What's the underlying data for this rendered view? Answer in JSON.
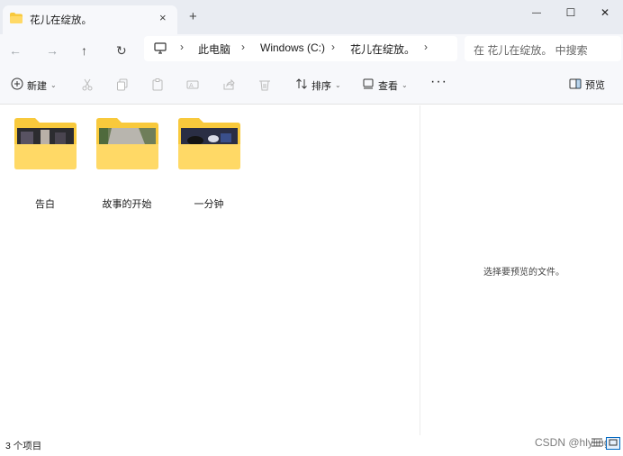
{
  "window": {
    "tab_title": "花儿在绽放。",
    "tab_close": "×",
    "new_tab": "+",
    "minimize": "—",
    "maximize": "☐",
    "close": "✕"
  },
  "nav": {
    "back": "←",
    "forward": "→",
    "up": "↑",
    "refresh": "↻"
  },
  "address": {
    "segments": [
      "此电脑",
      "Windows (C:)",
      "花儿在绽放。"
    ],
    "separator": "›"
  },
  "search": {
    "placeholder": "在 花儿在绽放。 中搜索"
  },
  "toolbar": {
    "new_label": "新建",
    "sort_label": "排序",
    "view_label": "查看",
    "more_label": "···",
    "preview_label": "预览",
    "caret": "⌄"
  },
  "folders": [
    {
      "name": "告白",
      "thumb": "dark-photo"
    },
    {
      "name": "故事的开始",
      "thumb": "road-photo"
    },
    {
      "name": "一分钟",
      "thumb": "table-photo"
    }
  ],
  "preview_pane": {
    "message": "选择要预览的文件。"
  },
  "status": {
    "item_count": "3 个项目"
  },
  "watermark": "CSDN @hlyling",
  "colors": {
    "folder_yellow": "#f8c93c",
    "folder_front": "#ffd966",
    "chrome_bg": "#e9ecf2",
    "toolbar_bg": "#f7f8fb",
    "accent": "#0067c0"
  }
}
